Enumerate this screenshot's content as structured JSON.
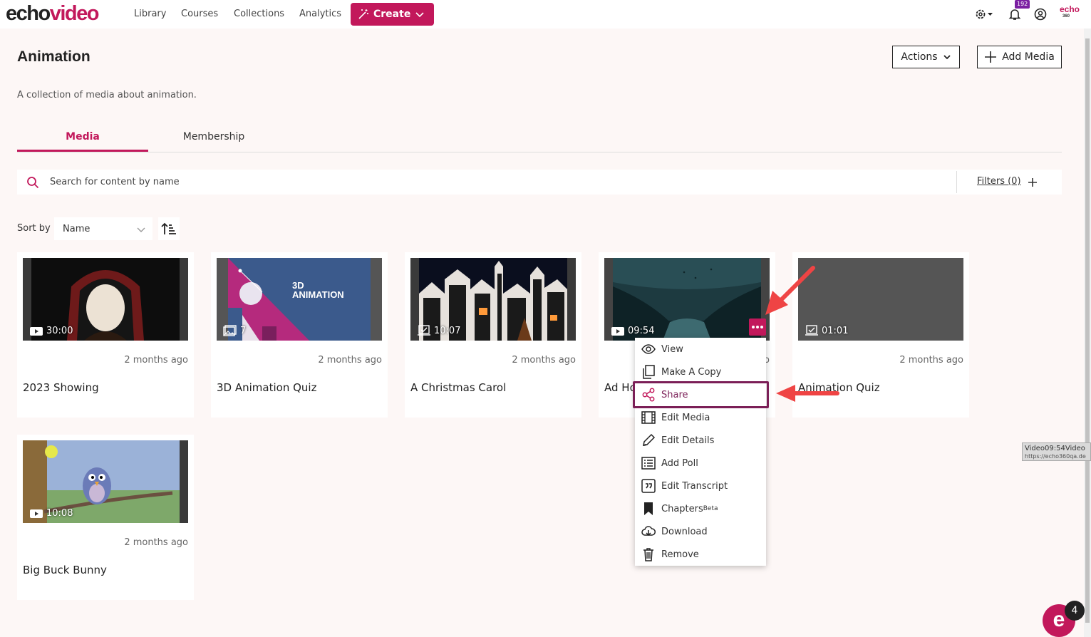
{
  "app": {
    "logo_part1": "echo",
    "logo_part2": "video"
  },
  "nav": {
    "items": [
      "Library",
      "Courses",
      "Collections",
      "Analytics"
    ],
    "create_label": "Create"
  },
  "notifications": {
    "count": "192"
  },
  "brand": {
    "badge_line1": "echo",
    "badge_line2": "360"
  },
  "page": {
    "title": "Animation",
    "description": "A collection of media about animation.",
    "actions_label": "Actions",
    "add_media_label": "Add Media"
  },
  "tabs": [
    {
      "label": "Media",
      "active": true
    },
    {
      "label": "Membership",
      "active": false
    }
  ],
  "search": {
    "placeholder": "Search for content by name",
    "filters_label": "Filters (0)"
  },
  "sort": {
    "label": "Sort by",
    "value": "Name"
  },
  "media": [
    {
      "title": "2023 Showing",
      "duration": "30:00",
      "type": "video",
      "age": "2 months ago"
    },
    {
      "title": "3D Animation Quiz",
      "duration": "7",
      "type": "image",
      "age": "2 months ago",
      "thumb_text": "3D ANIMATION"
    },
    {
      "title": "A Christmas Carol",
      "duration": "10:07",
      "type": "quiz",
      "age": "2 months ago"
    },
    {
      "title": "Ad Ho",
      "duration": "09:54",
      "type": "video",
      "age": "o"
    },
    {
      "title": "Animation Quiz",
      "duration": "01:01",
      "type": "quiz",
      "age": "2 months ago"
    },
    {
      "title": "Big Buck Bunny",
      "duration": "10:08",
      "type": "video",
      "age": "2 months ago"
    }
  ],
  "context_menu": {
    "items": [
      "View",
      "Make A Copy",
      "Share",
      "Edit Media",
      "Edit Details",
      "Add Poll",
      "Edit Transcript",
      "Chapters",
      "Download",
      "Remove"
    ],
    "chapters_badge": "Beta",
    "highlighted": "Share"
  },
  "tooltip": {
    "line1": "Video09:54Video",
    "line2": "https://echo360qa.de"
  },
  "help": {
    "label": "e",
    "badge": "4"
  },
  "colors": {
    "accent": "#c2185b",
    "highlight": "#7b1f57",
    "arrow": "#ef4444"
  }
}
